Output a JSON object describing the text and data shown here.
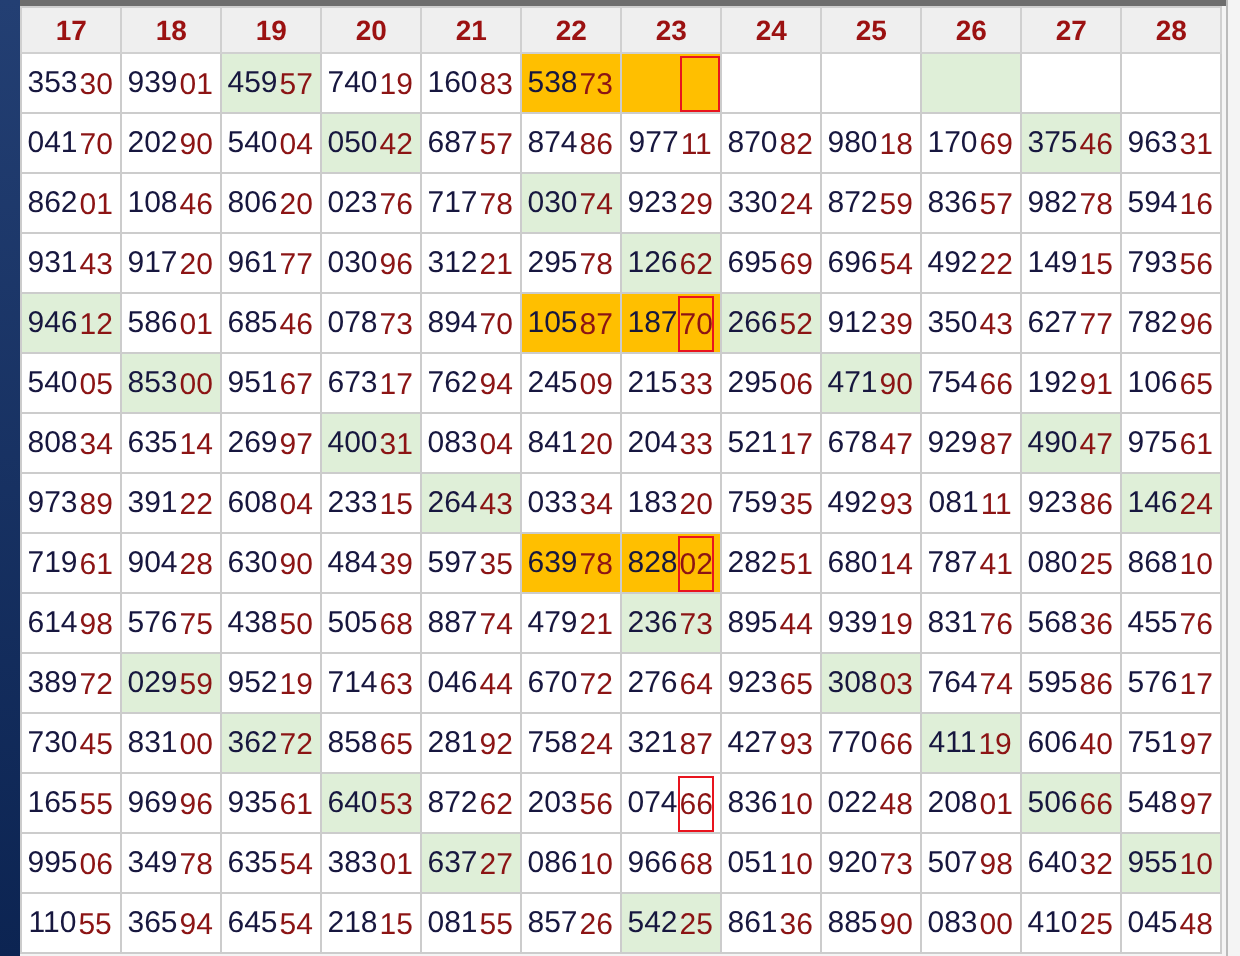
{
  "columns": [
    "17",
    "18",
    "19",
    "20",
    "21",
    "22",
    "23",
    "24",
    "25",
    "26",
    "27",
    "28"
  ],
  "rows": [
    {
      "cells": [
        {
          "value": "35330",
          "boxed": false
        },
        {
          "value": "93901",
          "boxed": false
        },
        {
          "value": "45957",
          "color": "#dfefd8",
          "boxed": false
        },
        {
          "value": "74019",
          "boxed": false
        },
        {
          "value": "16083",
          "boxed": false
        },
        {
          "value": "53873",
          "color": "#ffbf00",
          "boxed": false
        },
        {
          "color": "#ffbf00",
          "boxed": true
        },
        {
          "boxed": false
        },
        {
          "boxed": false
        },
        {
          "color": "#dfefd8",
          "boxed": false
        },
        {
          "boxed": false
        },
        {
          "boxed": false
        }
      ]
    },
    {
      "cells": [
        {
          "value": "04170",
          "boxed": false
        },
        {
          "value": "20290",
          "boxed": false
        },
        {
          "value": "54004",
          "boxed": false
        },
        {
          "value": "05042",
          "color": "#dfefd8",
          "boxed": false
        },
        {
          "value": "68757",
          "boxed": false
        },
        {
          "value": "87486",
          "boxed": false
        },
        {
          "value": "97711",
          "boxed": false
        },
        {
          "value": "87082",
          "boxed": false
        },
        {
          "value": "98018",
          "boxed": false
        },
        {
          "value": "17069",
          "boxed": false
        },
        {
          "value": "37546",
          "color": "#dfefd8",
          "boxed": false
        },
        {
          "value": "96331",
          "boxed": false
        }
      ]
    },
    {
      "cells": [
        {
          "value": "86201",
          "boxed": false
        },
        {
          "value": "10846",
          "boxed": false
        },
        {
          "value": "80620",
          "boxed": false
        },
        {
          "value": "02376",
          "boxed": false
        },
        {
          "value": "71778",
          "boxed": false
        },
        {
          "value": "03074",
          "color": "#dfefd8",
          "boxed": false
        },
        {
          "value": "92329",
          "boxed": false
        },
        {
          "value": "33024",
          "boxed": false
        },
        {
          "value": "87259",
          "boxed": false
        },
        {
          "value": "83657",
          "boxed": false
        },
        {
          "value": "98278",
          "boxed": false
        },
        {
          "value": "59416",
          "boxed": false
        }
      ]
    },
    {
      "cells": [
        {
          "value": "93143",
          "boxed": false
        },
        {
          "value": "91720",
          "boxed": false
        },
        {
          "value": "96177",
          "boxed": false
        },
        {
          "value": "03096",
          "boxed": false
        },
        {
          "value": "31221",
          "boxed": false
        },
        {
          "value": "29578",
          "boxed": false
        },
        {
          "value": "12662",
          "color": "#dfefd8",
          "boxed": false
        },
        {
          "value": "69569",
          "boxed": false
        },
        {
          "value": "69654",
          "boxed": false
        },
        {
          "value": "49222",
          "boxed": false
        },
        {
          "value": "14915",
          "boxed": false
        },
        {
          "value": "79356",
          "boxed": false
        }
      ]
    },
    {
      "cells": [
        {
          "value": "94612",
          "color": "#dfefd8",
          "boxed": false
        },
        {
          "value": "58601",
          "boxed": false
        },
        {
          "value": "68546",
          "boxed": false
        },
        {
          "value": "07873",
          "boxed": false
        },
        {
          "value": "89470",
          "boxed": false
        },
        {
          "value": "10587",
          "color": "#ffbf00",
          "boxed": false
        },
        {
          "value": "18770",
          "color": "#ffbf00",
          "boxed": true
        },
        {
          "value": "26652",
          "color": "#dfefd8",
          "boxed": false
        },
        {
          "value": "91239",
          "boxed": false
        },
        {
          "value": "35043",
          "boxed": false
        },
        {
          "value": "62777",
          "boxed": false
        },
        {
          "value": "78296",
          "boxed": false
        }
      ]
    },
    {
      "cells": [
        {
          "value": "54005",
          "boxed": false
        },
        {
          "value": "85300",
          "color": "#dfefd8",
          "boxed": false
        },
        {
          "value": "95167",
          "boxed": false
        },
        {
          "value": "67317",
          "boxed": false
        },
        {
          "value": "76294",
          "boxed": false
        },
        {
          "value": "24509",
          "boxed": false
        },
        {
          "value": "21533",
          "boxed": false
        },
        {
          "value": "29506",
          "boxed": false
        },
        {
          "value": "47190",
          "color": "#dfefd8",
          "boxed": false
        },
        {
          "value": "75466",
          "boxed": false
        },
        {
          "value": "19291",
          "boxed": false
        },
        {
          "value": "10665",
          "boxed": false
        }
      ]
    },
    {
      "cells": [
        {
          "value": "80834",
          "boxed": false
        },
        {
          "value": "63514",
          "boxed": false
        },
        {
          "value": "26997",
          "boxed": false
        },
        {
          "value": "40031",
          "color": "#dfefd8",
          "boxed": false
        },
        {
          "value": "08304",
          "boxed": false
        },
        {
          "value": "84120",
          "boxed": false
        },
        {
          "value": "20433",
          "boxed": false
        },
        {
          "value": "52117",
          "boxed": false
        },
        {
          "value": "67847",
          "boxed": false
        },
        {
          "value": "92987",
          "boxed": false
        },
        {
          "value": "49047",
          "color": "#dfefd8",
          "boxed": false
        },
        {
          "value": "97561",
          "boxed": false
        }
      ]
    },
    {
      "cells": [
        {
          "value": "97389",
          "boxed": false
        },
        {
          "value": "39122",
          "boxed": false
        },
        {
          "value": "60804",
          "boxed": false
        },
        {
          "value": "23315",
          "boxed": false
        },
        {
          "value": "26443",
          "color": "#dfefd8",
          "boxed": false
        },
        {
          "value": "03334",
          "boxed": false
        },
        {
          "value": "18320",
          "boxed": false
        },
        {
          "value": "75935",
          "boxed": false
        },
        {
          "value": "49293",
          "boxed": false
        },
        {
          "value": "08111",
          "boxed": false
        },
        {
          "value": "92386",
          "boxed": false
        },
        {
          "value": "14624",
          "color": "#dfefd8",
          "boxed": false
        }
      ]
    },
    {
      "cells": [
        {
          "value": "71961",
          "boxed": false
        },
        {
          "value": "90428",
          "boxed": false
        },
        {
          "value": "63090",
          "boxed": false
        },
        {
          "value": "48439",
          "boxed": false
        },
        {
          "value": "59735",
          "boxed": false
        },
        {
          "value": "63978",
          "color": "#ffbf00",
          "boxed": false
        },
        {
          "value": "82802",
          "color": "#ffbf00",
          "boxed": true
        },
        {
          "value": "28251",
          "boxed": false
        },
        {
          "value": "68014",
          "boxed": false
        },
        {
          "value": "78741",
          "boxed": false
        },
        {
          "value": "08025",
          "boxed": false
        },
        {
          "value": "86810",
          "boxed": false
        }
      ]
    },
    {
      "cells": [
        {
          "value": "61498",
          "boxed": false
        },
        {
          "value": "57675",
          "boxed": false
        },
        {
          "value": "43850",
          "boxed": false
        },
        {
          "value": "50568",
          "boxed": false
        },
        {
          "value": "88774",
          "boxed": false
        },
        {
          "value": "47921",
          "boxed": false
        },
        {
          "value": "23673",
          "color": "#dfefd8",
          "boxed": false
        },
        {
          "value": "89544",
          "boxed": false
        },
        {
          "value": "93919",
          "boxed": false
        },
        {
          "value": "83176",
          "boxed": false
        },
        {
          "value": "56836",
          "boxed": false
        },
        {
          "value": "45576",
          "boxed": false
        }
      ]
    },
    {
      "cells": [
        {
          "value": "38972",
          "boxed": false
        },
        {
          "value": "02959",
          "color": "#dfefd8",
          "boxed": false
        },
        {
          "value": "95219",
          "boxed": false
        },
        {
          "value": "71463",
          "boxed": false
        },
        {
          "value": "04644",
          "boxed": false
        },
        {
          "value": "67072",
          "boxed": false
        },
        {
          "value": "27664",
          "boxed": false
        },
        {
          "value": "92365",
          "boxed": false
        },
        {
          "value": "30803",
          "color": "#dfefd8",
          "boxed": false
        },
        {
          "value": "76474",
          "boxed": false
        },
        {
          "value": "59586",
          "boxed": false
        },
        {
          "value": "57617",
          "boxed": false
        }
      ]
    },
    {
      "cells": [
        {
          "value": "73045",
          "boxed": false
        },
        {
          "value": "83100",
          "boxed": false
        },
        {
          "value": "36272",
          "color": "#dfefd8",
          "boxed": false
        },
        {
          "value": "85865",
          "boxed": false
        },
        {
          "value": "28192",
          "boxed": false
        },
        {
          "value": "75824",
          "boxed": false
        },
        {
          "value": "32187",
          "boxed": false
        },
        {
          "value": "42793",
          "boxed": false
        },
        {
          "value": "77066",
          "boxed": false
        },
        {
          "value": "41119",
          "color": "#dfefd8",
          "boxed": false
        },
        {
          "value": "60640",
          "boxed": false
        },
        {
          "value": "75197",
          "boxed": false
        }
      ]
    },
    {
      "cells": [
        {
          "value": "16555",
          "boxed": false
        },
        {
          "value": "96996",
          "boxed": false
        },
        {
          "value": "93561",
          "boxed": false
        },
        {
          "value": "64053",
          "color": "#dfefd8",
          "boxed": false
        },
        {
          "value": "87262",
          "boxed": false
        },
        {
          "value": "20356",
          "boxed": false
        },
        {
          "value": "07466",
          "boxed": true
        },
        {
          "value": "83610",
          "boxed": false
        },
        {
          "value": "02248",
          "boxed": false
        },
        {
          "value": "20801",
          "boxed": false
        },
        {
          "value": "50666",
          "color": "#dfefd8",
          "boxed": false
        },
        {
          "value": "54897",
          "boxed": false
        }
      ]
    },
    {
      "cells": [
        {
          "value": "99506",
          "boxed": false
        },
        {
          "value": "34978",
          "boxed": false
        },
        {
          "value": "63554",
          "boxed": false
        },
        {
          "value": "38301",
          "boxed": false
        },
        {
          "value": "63727",
          "color": "#dfefd8",
          "boxed": false
        },
        {
          "value": "08610",
          "boxed": false
        },
        {
          "value": "96668",
          "boxed": false
        },
        {
          "value": "05110",
          "boxed": false
        },
        {
          "value": "92073",
          "boxed": false
        },
        {
          "value": "50798",
          "boxed": false
        },
        {
          "value": "64032",
          "boxed": false
        },
        {
          "value": "95510",
          "color": "#dfefd8",
          "boxed": false
        }
      ]
    },
    {
      "cells": [
        {
          "value": "11055",
          "boxed": false
        },
        {
          "value": "36594",
          "boxed": false
        },
        {
          "value": "64554",
          "boxed": false
        },
        {
          "value": "21815",
          "boxed": false
        },
        {
          "value": "08155",
          "boxed": false
        },
        {
          "value": "85726",
          "boxed": false
        },
        {
          "value": "54225",
          "color": "#dfefd8",
          "boxed": false
        },
        {
          "value": "86136",
          "boxed": false
        },
        {
          "value": "88590",
          "boxed": false
        },
        {
          "value": "08300",
          "boxed": false
        },
        {
          "value": "41025",
          "boxed": false
        },
        {
          "value": "04548",
          "boxed": false
        }
      ]
    }
  ]
}
